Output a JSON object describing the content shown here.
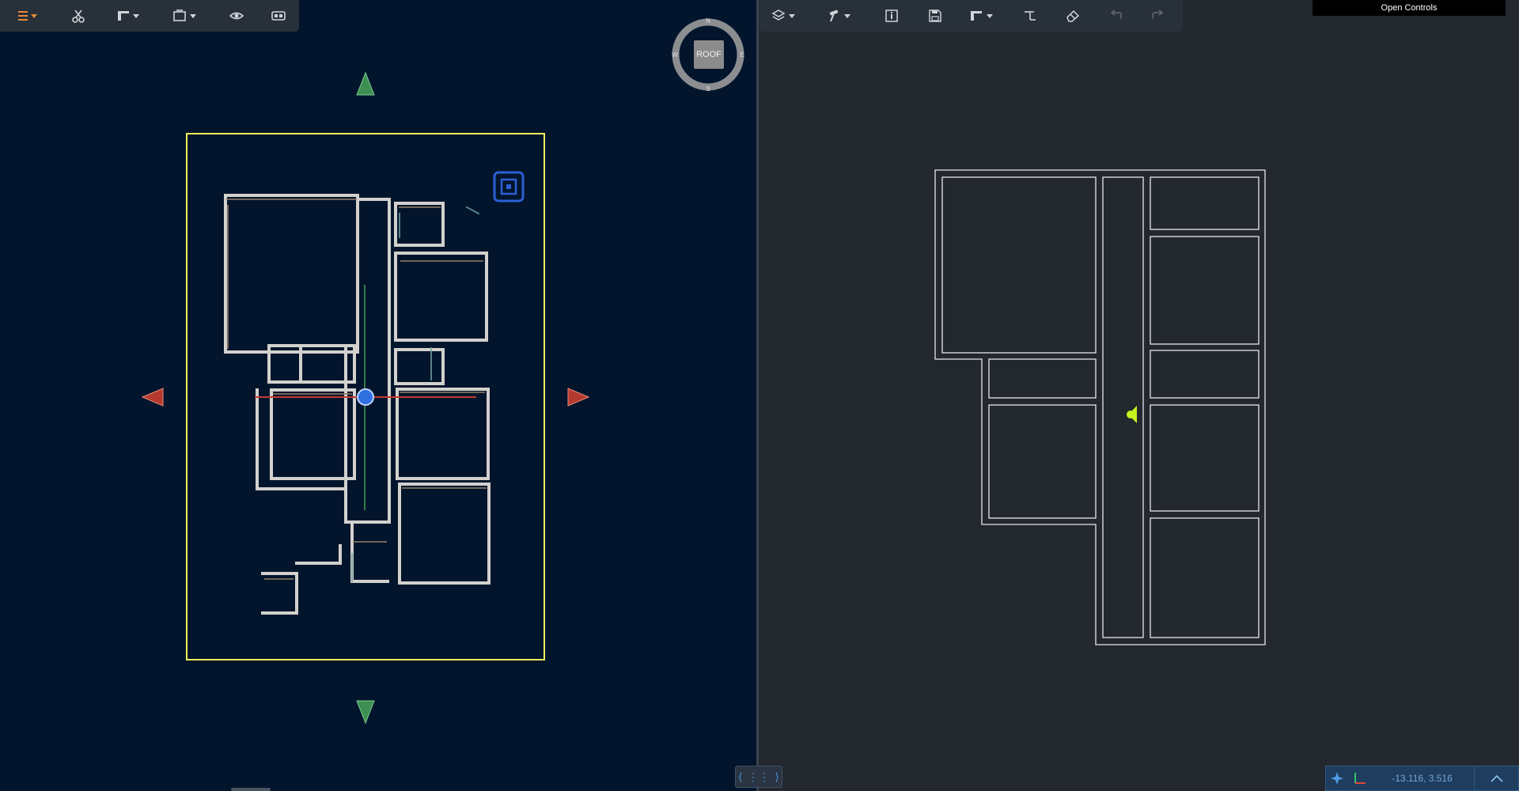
{
  "left_toolbar": {
    "icons": [
      "menu-icon",
      "scissors-icon",
      "floorplan-icon",
      "box-icon",
      "eye-icon",
      "panel-icon"
    ]
  },
  "compass": {
    "north": "N",
    "south": "S",
    "east": "E",
    "west": "W",
    "roof_label": "ROOF"
  },
  "right_toolbar": {
    "icons": [
      "layers-icon",
      "hammer-icon",
      "info-icon",
      "save-icon",
      "floorplan-icon",
      "measure-icon",
      "eraser-icon",
      "undo-icon",
      "redo-icon"
    ]
  },
  "open_controls_label": "Open Controls",
  "status_bar": {
    "coordinates": "-13.116, 3.516"
  },
  "colors": {
    "viewport_bg": "#02152c",
    "plan_bg": "#23282f",
    "selection_box": "#f2f25a",
    "nav_arrow_green": "#3e8f52",
    "nav_arrow_red": "#b53a2e",
    "cursor_blue": "#2f6fe0",
    "marker_lime": "#c6f41f"
  }
}
